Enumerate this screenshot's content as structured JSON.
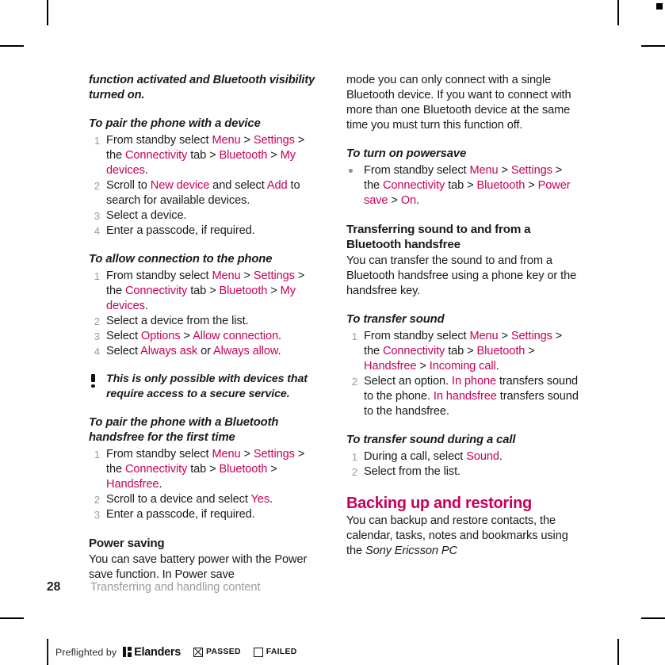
{
  "page": {
    "number": "28",
    "chapter": "Transferring and handling content",
    "accent_color": "#C8005A",
    "muted_color": "#9b9b9b"
  },
  "left_column": {
    "intro_continued": "function activated and Bluetooth visibility turned on.",
    "sections": [
      {
        "heading": "To pair the phone with a device",
        "steps": [
          {
            "number": "1",
            "parts": [
              {
                "t": "From standby select ",
                "hl": false
              },
              {
                "t": "Menu",
                "hl": true
              },
              {
                "t": " > ",
                "hl": false
              },
              {
                "t": "Settings",
                "hl": true
              },
              {
                "t": " > the ",
                "hl": false
              },
              {
                "t": "Connectivity",
                "hl": true
              },
              {
                "t": " tab > ",
                "hl": false
              },
              {
                "t": "Bluetooth",
                "hl": true
              },
              {
                "t": " > ",
                "hl": false
              },
              {
                "t": "My devices",
                "hl": true
              },
              {
                "t": ".",
                "hl": false
              }
            ]
          },
          {
            "number": "2",
            "parts": [
              {
                "t": "Scroll to ",
                "hl": false
              },
              {
                "t": "New device",
                "hl": true
              },
              {
                "t": " and select ",
                "hl": false
              },
              {
                "t": "Add",
                "hl": true
              },
              {
                "t": " to search for available devices.",
                "hl": false
              }
            ]
          },
          {
            "number": "3",
            "parts": [
              {
                "t": "Select a device.",
                "hl": false
              }
            ]
          },
          {
            "number": "4",
            "parts": [
              {
                "t": "Enter a passcode, if required.",
                "hl": false
              }
            ]
          }
        ]
      },
      {
        "heading": "To allow connection to the phone",
        "steps": [
          {
            "number": "1",
            "parts": [
              {
                "t": "From standby select ",
                "hl": false
              },
              {
                "t": "Menu",
                "hl": true
              },
              {
                "t": " > ",
                "hl": false
              },
              {
                "t": "Settings",
                "hl": true
              },
              {
                "t": " > the ",
                "hl": false
              },
              {
                "t": "Connectivity",
                "hl": true
              },
              {
                "t": " tab > ",
                "hl": false
              },
              {
                "t": "Bluetooth",
                "hl": true
              },
              {
                "t": " > ",
                "hl": false
              },
              {
                "t": "My devices",
                "hl": true
              },
              {
                "t": ".",
                "hl": false
              }
            ]
          },
          {
            "number": "2",
            "parts": [
              {
                "t": "Select a device from the list.",
                "hl": false
              }
            ]
          },
          {
            "number": "3",
            "parts": [
              {
                "t": "Select ",
                "hl": false
              },
              {
                "t": "Options",
                "hl": true
              },
              {
                "t": " > ",
                "hl": false
              },
              {
                "t": "Allow connection",
                "hl": true
              },
              {
                "t": ".",
                "hl": false
              }
            ]
          },
          {
            "number": "4",
            "parts": [
              {
                "t": "Select ",
                "hl": false
              },
              {
                "t": "Always ask",
                "hl": true
              },
              {
                "t": " or ",
                "hl": false
              },
              {
                "t": "Always allow",
                "hl": true
              },
              {
                "t": ".",
                "hl": false
              }
            ]
          }
        ]
      }
    ],
    "note": {
      "icon": "exclamation-icon",
      "text": "This is only possible with devices that require access to a secure service."
    },
    "handsfree_section": {
      "heading": "To pair the phone with a Bluetooth handsfree for the first time",
      "steps": [
        {
          "number": "1",
          "parts": [
            {
              "t": "From standby select ",
              "hl": false
            },
            {
              "t": "Menu",
              "hl": true
            },
            {
              "t": " > ",
              "hl": false
            },
            {
              "t": "Settings",
              "hl": true
            },
            {
              "t": " > the ",
              "hl": false
            },
            {
              "t": "Connectivity",
              "hl": true
            },
            {
              "t": " tab > ",
              "hl": false
            },
            {
              "t": "Bluetooth",
              "hl": true
            },
            {
              "t": " > ",
              "hl": false
            },
            {
              "t": "Handsfree",
              "hl": true
            },
            {
              "t": ".",
              "hl": false
            }
          ]
        },
        {
          "number": "2",
          "parts": [
            {
              "t": "Scroll to a device and select ",
              "hl": false
            },
            {
              "t": "Yes",
              "hl": true
            },
            {
              "t": ".",
              "hl": false
            }
          ]
        },
        {
          "number": "3",
          "parts": [
            {
              "t": "Enter a passcode, if required.",
              "hl": false
            }
          ]
        }
      ]
    },
    "power_saving": {
      "heading": "Power saving",
      "body": "You can save battery power with the Power save function. In Power save"
    }
  },
  "right_column": {
    "power_saving_continued": "mode you can only connect with a single Bluetooth device. If you want to connect with more than one Bluetooth device at the same time you must turn this function off.",
    "powersave_section": {
      "heading": "To turn on powersave",
      "bullets": [
        {
          "parts": [
            {
              "t": "From standby select ",
              "hl": false
            },
            {
              "t": "Menu",
              "hl": true
            },
            {
              "t": " > ",
              "hl": false
            },
            {
              "t": "Settings",
              "hl": true
            },
            {
              "t": " > the ",
              "hl": false
            },
            {
              "t": "Connectivity",
              "hl": true
            },
            {
              "t": " tab > ",
              "hl": false
            },
            {
              "t": "Bluetooth",
              "hl": true
            },
            {
              "t": " > ",
              "hl": false
            },
            {
              "t": "Power save",
              "hl": true
            },
            {
              "t": " > ",
              "hl": false
            },
            {
              "t": "On",
              "hl": true
            },
            {
              "t": ".",
              "hl": false
            }
          ]
        }
      ]
    },
    "transfer_section": {
      "heading": "Transferring sound to and from a Bluetooth handsfree",
      "body": "You can transfer the sound to and from a Bluetooth handsfree using a phone key or the handsfree key."
    },
    "to_transfer_sound": {
      "heading": "To transfer sound",
      "steps": [
        {
          "number": "1",
          "parts": [
            {
              "t": "From standby select ",
              "hl": false
            },
            {
              "t": "Menu",
              "hl": true
            },
            {
              "t": " > ",
              "hl": false
            },
            {
              "t": "Settings",
              "hl": true
            },
            {
              "t": " > the ",
              "hl": false
            },
            {
              "t": "Connectivity",
              "hl": true
            },
            {
              "t": " tab > ",
              "hl": false
            },
            {
              "t": "Bluetooth",
              "hl": true
            },
            {
              "t": " > ",
              "hl": false
            },
            {
              "t": "Handsfree",
              "hl": true
            },
            {
              "t": " > ",
              "hl": false
            },
            {
              "t": "Incoming call",
              "hl": true
            },
            {
              "t": ".",
              "hl": false
            }
          ]
        },
        {
          "number": "2",
          "parts": [
            {
              "t": "Select an option. ",
              "hl": false
            },
            {
              "t": "In phone",
              "hl": true
            },
            {
              "t": " transfers sound to the phone. ",
              "hl": false
            },
            {
              "t": "In handsfree",
              "hl": true
            },
            {
              "t": " transfers sound to the handsfree.",
              "hl": false
            }
          ]
        }
      ]
    },
    "to_transfer_during_call": {
      "heading": "To transfer sound during a call",
      "steps": [
        {
          "number": "1",
          "parts": [
            {
              "t": "During a call, select ",
              "hl": false
            },
            {
              "t": "Sound",
              "hl": true
            },
            {
              "t": ".",
              "hl": false
            }
          ]
        },
        {
          "number": "2",
          "parts": [
            {
              "t": "Select from the list.",
              "hl": false
            }
          ]
        }
      ]
    },
    "backing_up": {
      "heading": "Backing up and restoring",
      "body_parts": [
        {
          "t": "You can backup and restore contacts, the calendar, tasks, notes and bookmarks using the ",
          "it": false
        },
        {
          "t": "Sony Ericsson PC",
          "it": true
        }
      ]
    }
  },
  "preflight": {
    "label": "Preflighted by",
    "brand": "Elanders",
    "passed_label": "PASSED",
    "failed_label": "FAILED",
    "passed_checked": true,
    "failed_checked": false
  }
}
